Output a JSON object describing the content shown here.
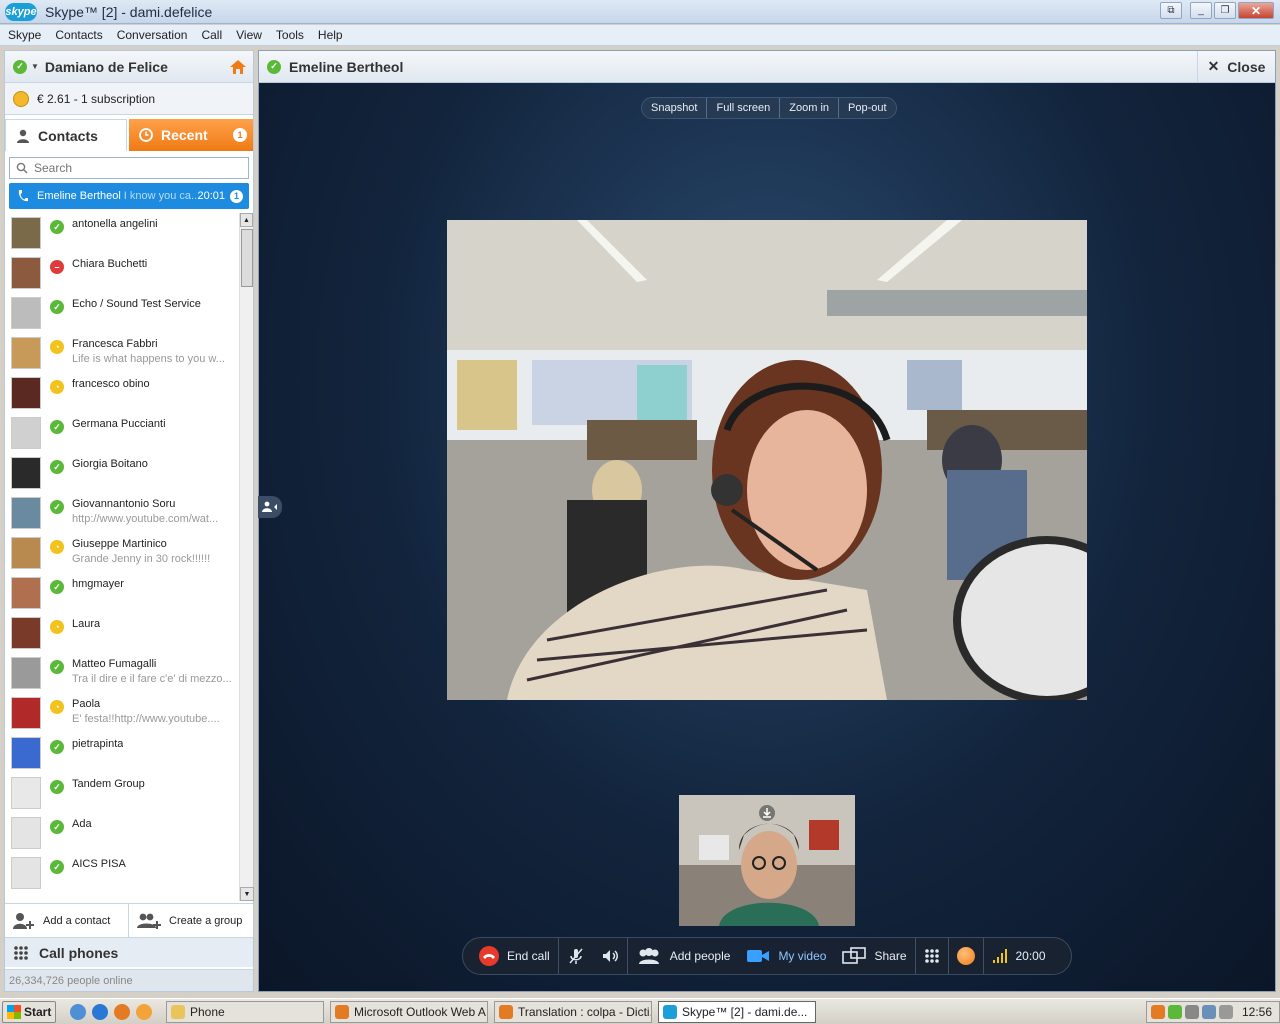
{
  "window": {
    "title": "Skype™ [2] - dami.defelice",
    "logo_text": "skype"
  },
  "menu": [
    "Skype",
    "Contacts",
    "Conversation",
    "Call",
    "View",
    "Tools",
    "Help"
  ],
  "user": {
    "name": "Damiano de Felice",
    "credit": "€ 2.61 - 1 subscription"
  },
  "tabs": {
    "contacts": "Contacts",
    "recent": "Recent",
    "recent_badge": "1"
  },
  "search": {
    "placeholder": "Search"
  },
  "active_call": {
    "name": "Emeline Bertheol",
    "preview": "I know you ca...",
    "time": "20:01",
    "badge": "1"
  },
  "contacts": [
    {
      "name": "antonella angelini",
      "mood": "",
      "status": "online",
      "avatar": "#7a6a4a"
    },
    {
      "name": "Chiara Buchetti",
      "mood": "",
      "status": "busy",
      "avatar": "#8c5a3e"
    },
    {
      "name": "Echo / Sound Test Service",
      "mood": "",
      "status": "online",
      "avatar": "#bcbcbc"
    },
    {
      "name": "Francesca Fabbri",
      "mood": "Life is what happens to you w...",
      "status": "away",
      "avatar": "#c89a5a"
    },
    {
      "name": "francesco obino",
      "mood": "",
      "status": "away",
      "avatar": "#5a2a22"
    },
    {
      "name": "Germana Puccianti",
      "mood": "",
      "status": "online",
      "avatar": "#d0d0d0"
    },
    {
      "name": "Giorgia Boitano",
      "mood": "",
      "status": "online",
      "avatar": "#2a2a2a"
    },
    {
      "name": "Giovannantonio Soru",
      "mood": "http://www.youtube.com/wat...",
      "status": "online",
      "avatar": "#6a8aa0"
    },
    {
      "name": "Giuseppe Martinico",
      "mood": "Grande Jenny in 30 rock!!!!!!",
      "status": "away",
      "avatar": "#b88a50"
    },
    {
      "name": "hmgmayer",
      "mood": "",
      "status": "online",
      "avatar": "#b07050"
    },
    {
      "name": "Laura",
      "mood": "",
      "status": "away",
      "avatar": "#7a3a2a"
    },
    {
      "name": "Matteo Fumagalli",
      "mood": "Tra il dire e il fare c'e' di mezzo...",
      "status": "online",
      "avatar": "#9a9a9a"
    },
    {
      "name": "Paola",
      "mood": "E' festa!!http://www.youtube....",
      "status": "away",
      "avatar": "#b02a2a"
    },
    {
      "name": "pietrapinta",
      "mood": "",
      "status": "online",
      "avatar": "#3a6ad0"
    },
    {
      "name": "Tandem Group",
      "mood": "",
      "status": "online",
      "avatar": "#e8e8e8"
    },
    {
      "name": "Ada",
      "mood": "",
      "status": "online",
      "avatar": "#e4e4e4"
    },
    {
      "name": "AICS PISA",
      "mood": "",
      "status": "online",
      "avatar": "#e4e4e4"
    }
  ],
  "actions": {
    "add_contact": "Add a contact",
    "create_group": "Create a group",
    "call_phones": "Call phones",
    "online": "26,334,726 people online"
  },
  "call": {
    "header_name": "Emeline Bertheol",
    "close": "Close",
    "video_tools": [
      "Snapshot",
      "Full screen",
      "Zoom in",
      "Pop-out"
    ],
    "controls": {
      "end_call": "End call",
      "add_people": "Add people",
      "my_video": "My video",
      "share": "Share",
      "duration": "20:00"
    }
  },
  "taskbar": {
    "start": "Start",
    "buttons": [
      {
        "label": "Phone",
        "width": 158,
        "active": false
      },
      {
        "label": "Microsoft Outlook Web A...",
        "width": 158,
        "active": false
      },
      {
        "label": "Translation : colpa - Dicti...",
        "width": 158,
        "active": false
      },
      {
        "label": "Skype™ [2] - dami.de...",
        "width": 158,
        "active": true
      }
    ],
    "clock": "12:56"
  },
  "colors": {
    "online": "#5cb838",
    "away": "#f2c31c",
    "busy": "#e03b3b",
    "skype_blue": "#1a9fd9",
    "recent_orange": "#f07a14"
  }
}
